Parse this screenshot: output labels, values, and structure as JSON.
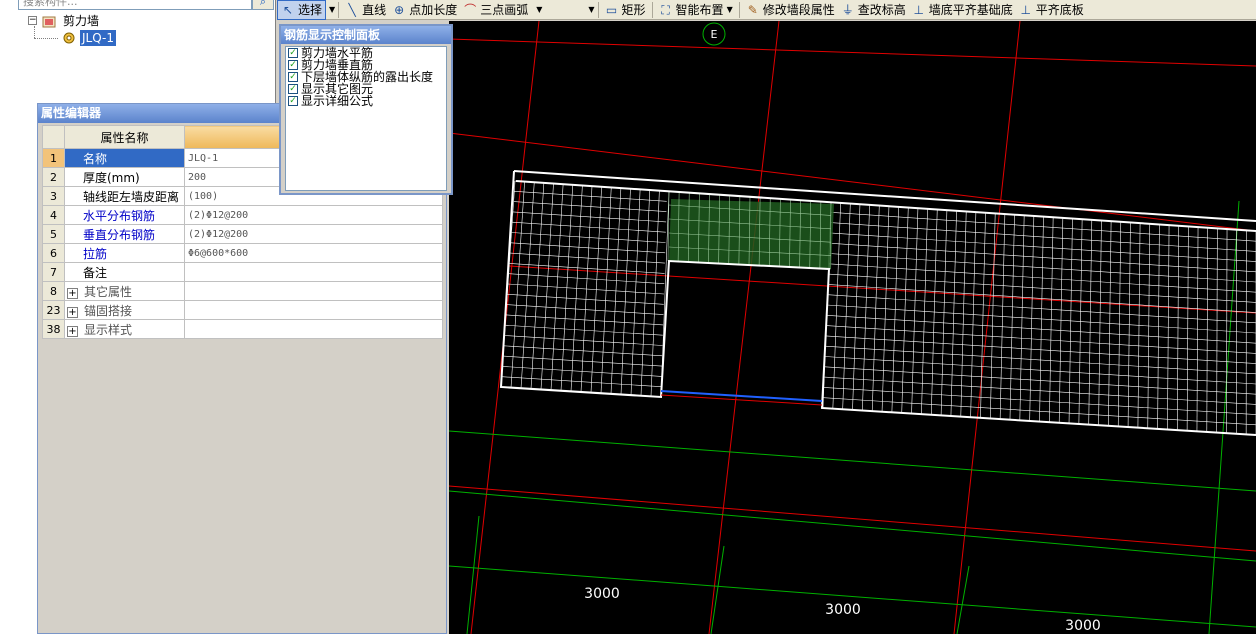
{
  "tree": {
    "search_placeholder": "搜索构件...",
    "search_button": "⌕",
    "nodes": [
      {
        "label": "剪力墙"
      },
      {
        "label": "JLQ-1"
      }
    ]
  },
  "toolbar": {
    "items": [
      {
        "label": "选择",
        "icon": "pointer-icon",
        "glyph": "↖"
      },
      {
        "label": "直线",
        "icon": "line-icon",
        "glyph": "╲"
      },
      {
        "label": "点加长度",
        "icon": "point-length-icon",
        "glyph": "⊕"
      },
      {
        "label": "三点画弧",
        "icon": "arc-icon",
        "glyph": "⌒"
      },
      {
        "label": "矩形",
        "icon": "rectangle-icon",
        "glyph": "▭"
      },
      {
        "label": "智能布置",
        "icon": "smart-layout-icon",
        "glyph": "⛶"
      },
      {
        "label": "修改墙段属性",
        "icon": "edit-wall-icon",
        "glyph": "✎"
      },
      {
        "label": "查改标高",
        "icon": "elevation-icon",
        "glyph": "⏚"
      },
      {
        "label": "墙底平齐基础底",
        "icon": "align-base-icon",
        "glyph": "⊥"
      },
      {
        "label": "平齐底板",
        "icon": "align-slab-icon",
        "glyph": "⊥"
      }
    ]
  },
  "property_editor": {
    "title": "属性编辑器",
    "column_header": "属性名称",
    "rows": [
      {
        "num": "1",
        "name": "名称",
        "value": "JLQ-1"
      },
      {
        "num": "2",
        "name": "厚度(mm)",
        "value": "200"
      },
      {
        "num": "3",
        "name": "轴线距左墙皮距离",
        "value": "(100)"
      },
      {
        "num": "4",
        "name": "水平分布钢筋",
        "value": "(2)Φ12@200"
      },
      {
        "num": "5",
        "name": "垂直分布钢筋",
        "value": "(2)Φ12@200"
      },
      {
        "num": "6",
        "name": "拉筋",
        "value": "Φ6@600*600"
      },
      {
        "num": "7",
        "name": "备注",
        "value": ""
      },
      {
        "num": "8",
        "name": "其它属性",
        "value": ""
      },
      {
        "num": "23",
        "name": "锚固搭接",
        "value": ""
      },
      {
        "num": "38",
        "name": "显示样式",
        "value": ""
      }
    ]
  },
  "control_panel": {
    "title": "钢筋显示控制面板",
    "options": [
      {
        "label": "剪力墙水平筋",
        "checked": true
      },
      {
        "label": "剪力墙垂直筋",
        "checked": true
      },
      {
        "label": "下层墙体纵筋的露出长度",
        "checked": true
      },
      {
        "label": "显示其它图元",
        "checked": true
      },
      {
        "label": "显示详细公式",
        "checked": true
      }
    ]
  },
  "canvas": {
    "axis_label": "E",
    "dimensions": [
      "3000",
      "3000",
      "3000"
    ],
    "colors": {
      "background": "#000000",
      "grid_red": "#e00000",
      "grid_green": "#00b000",
      "mesh": "#ffffff",
      "highlight": "#1f5c1f"
    }
  }
}
